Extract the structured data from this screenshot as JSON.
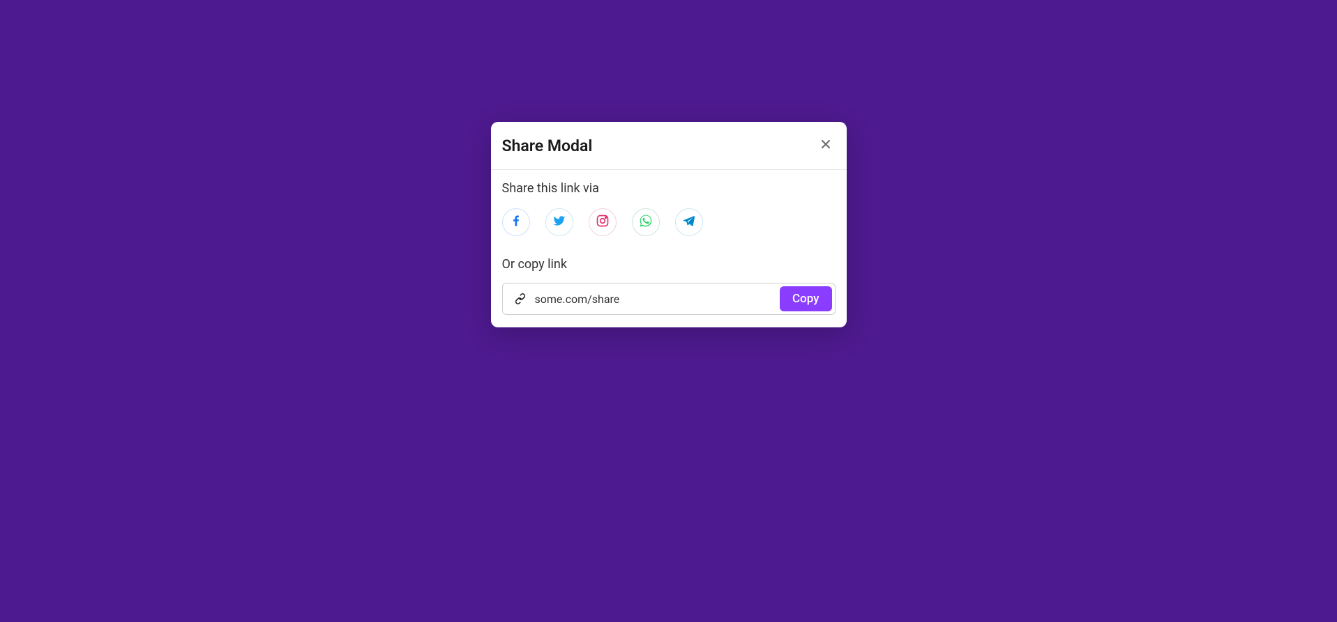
{
  "modal": {
    "title": "Share Modal",
    "shareLabel": "Share this link via",
    "copyLabel": "Or copy link",
    "linkValue": "some.com/share",
    "copyButtonLabel": "Copy"
  },
  "socialIcons": [
    {
      "name": "facebook",
      "color": "#1877f2"
    },
    {
      "name": "twitter",
      "color": "#1da1f2"
    },
    {
      "name": "instagram",
      "color": "#e1306c"
    },
    {
      "name": "whatsapp",
      "color": "#25d366"
    },
    {
      "name": "telegram",
      "color": "#0088cc"
    }
  ]
}
